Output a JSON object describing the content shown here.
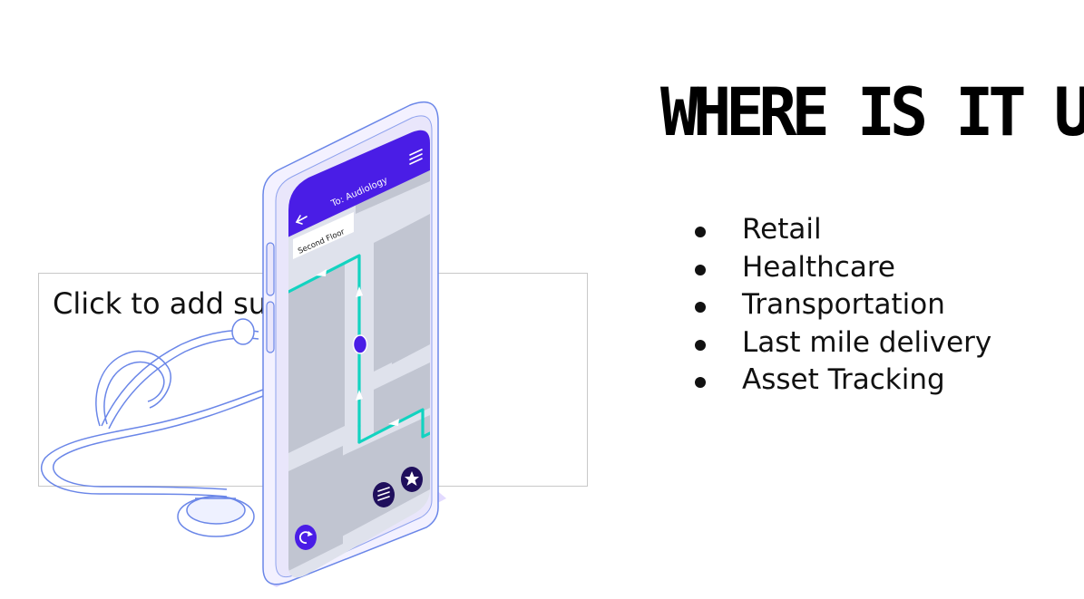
{
  "slide": {
    "title": "WHERE IS IT USEF",
    "subtitle_placeholder": "Click to add su",
    "bullets": [
      "Retail",
      "Healthcare",
      "Transportation",
      "Last mile delivery",
      "Asset Tracking"
    ]
  },
  "phone_screen": {
    "destination": "To: Audiology",
    "floor_label": "Second Floor"
  },
  "colors": {
    "phone_accent": "#4a1de6",
    "route": "#12d3c0",
    "outline": "#6a86e8",
    "map_background": "#dfe2ec",
    "map_blocks": "#c1c5d1"
  }
}
